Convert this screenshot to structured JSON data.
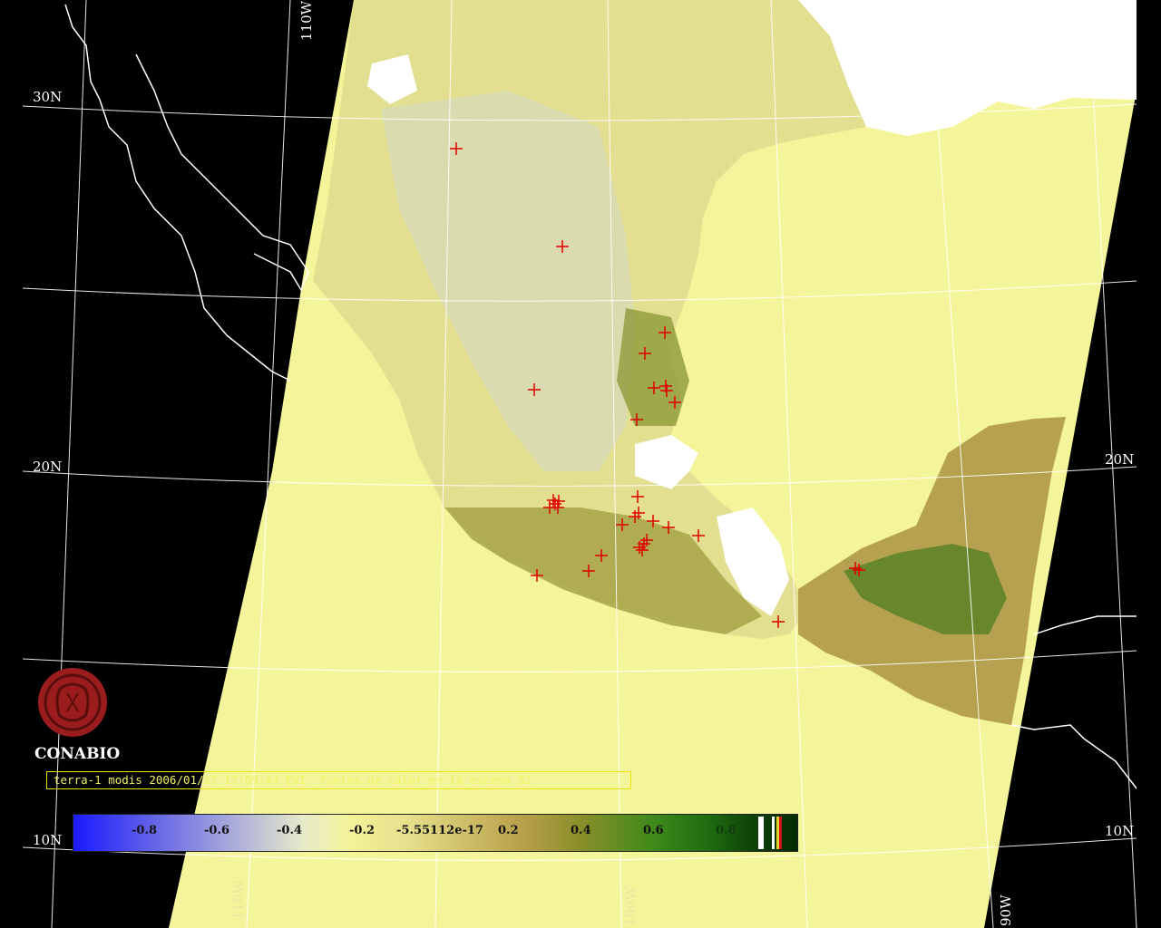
{
  "caption": "terra-1 modis 2006/01/17 17:09:44 EVI. Puntos de calor en la escena 32",
  "logo": {
    "text": "CONABIO",
    "color": "#9b1c1c"
  },
  "grid_labels": {
    "lon_110w_top": "110W",
    "lon_110w_bottom": "110W",
    "lon_100w_bottom": "100W",
    "lon_90w_bottom": "90W",
    "lat_30n": "30N",
    "lat_20n_left": "20N",
    "lat_20n_right": "20N",
    "lat_10n_left": "10N",
    "lat_10n_right": "10N"
  },
  "colorbar": {
    "ticks": [
      "-0.8",
      "-0.6",
      "-0.4",
      "-0.2",
      "-5.55112e-17",
      "0.2",
      "0.4",
      "0.6",
      "0.8"
    ]
  },
  "colors": {
    "background": "#000000",
    "swath": "#f4f59b",
    "hotspot": "#e00000",
    "coastline": "#ffffff"
  },
  "hotspot_count": 32
}
